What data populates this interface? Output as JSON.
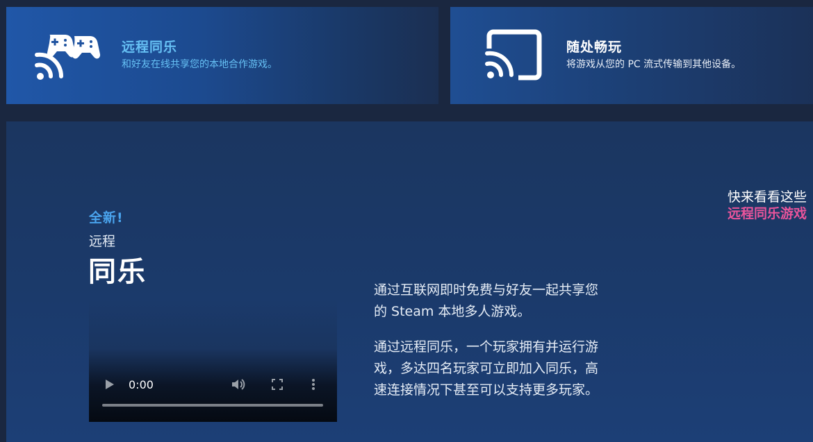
{
  "cards": [
    {
      "icon": "gamepad-broadcast-icon",
      "title": "远程同乐",
      "subtitle": "和好友在线共享您的本地合作游戏。"
    },
    {
      "icon": "cast-screen-icon",
      "title": "随处畅玩",
      "subtitle": "将游戏从您的 PC 流式传输到其他设备。"
    }
  ],
  "feature": {
    "badge": "全新!",
    "heading_small": "远程",
    "heading_big": "同乐",
    "paragraphs": [
      "通过互联网即时免费与好友一起共享您的 Steam 本地多人游戏。",
      "通过远程同乐，一个玩家拥有并运行游戏，多达四名玩家可立即加入同乐，高速连接情况下甚至可以支持更多玩家。"
    ]
  },
  "video": {
    "time": "0:00",
    "progress": 0
  },
  "side_link": {
    "line1": "快来看看这些",
    "line2": "远程同乐游戏"
  },
  "colors": {
    "accent_blue": "#66c0f4",
    "accent_pink": "#e8549b"
  }
}
